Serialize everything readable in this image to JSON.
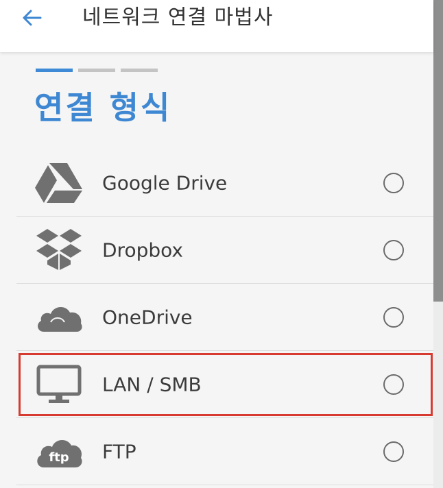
{
  "appbar": {
    "back_icon": "arrow-left-icon",
    "title": "네트워크 연결 마법사"
  },
  "progress": {
    "total_steps": 3,
    "current_step": 1
  },
  "section": {
    "title": "연결 형식"
  },
  "connection_types": [
    {
      "label": "Google Drive",
      "icon": "google-drive-icon",
      "selected": false
    },
    {
      "label": "Dropbox",
      "icon": "dropbox-icon",
      "selected": false
    },
    {
      "label": "OneDrive",
      "icon": "onedrive-icon",
      "selected": false
    },
    {
      "label": "LAN / SMB",
      "icon": "monitor-icon",
      "selected": false,
      "highlighted": true
    },
    {
      "label": "FTP",
      "icon": "ftp-cloud-icon",
      "icon_text": "ftp",
      "selected": false
    }
  ],
  "colors": {
    "accent": "#3e87d2",
    "highlight_border": "#d63a31",
    "icon_gray": "#6f6f6f"
  }
}
